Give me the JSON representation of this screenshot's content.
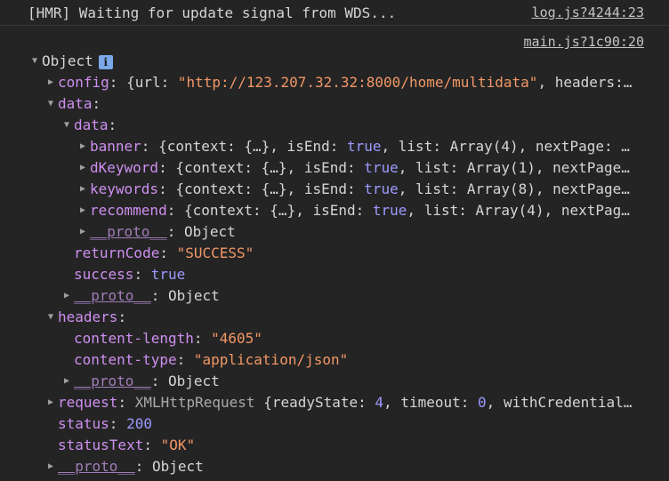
{
  "hmr": {
    "message": "[HMR] Waiting for update signal from WDS...",
    "source": "log.js?4244:23"
  },
  "group": {
    "source": "main.js?1c90:20"
  },
  "root": {
    "label": "Object",
    "info_icon": "info-icon",
    "info_text": "i"
  },
  "config": {
    "key": "config",
    "prefix": "{url: ",
    "url": "\"http://123.207.32.32:8000/home/multidata\"",
    "rest": ", headers:…"
  },
  "data": {
    "key": "data",
    "inner_key": "data",
    "banner": {
      "key": "banner",
      "a": "{context: {…}, isEnd: ",
      "isEnd": "true",
      "b": ", list: ",
      "list": "Array(4)",
      "c": ", nextPage: …"
    },
    "dKeyword": {
      "key": "dKeyword",
      "a": "{context: {…}, isEnd: ",
      "isEnd": "true",
      "b": ", list: ",
      "list": "Array(1)",
      "c": ", nextPage…"
    },
    "keywords": {
      "key": "keywords",
      "a": "{context: {…}, isEnd: ",
      "isEnd": "true",
      "b": ", list: ",
      "list": "Array(8)",
      "c": ", nextPage…"
    },
    "recommend": {
      "key": "recommend",
      "a": "{context: {…}, isEnd: ",
      "isEnd": "true",
      "b": ", list: ",
      "list": "Array(4)",
      "c": ", nextPag…"
    },
    "returnCode_key": "returnCode",
    "returnCode": "\"SUCCESS\"",
    "success_key": "success",
    "success": "true"
  },
  "headers": {
    "key": "headers",
    "content_length_key": "content-length",
    "content_length": "\"4605\"",
    "content_type_key": "content-type",
    "content_type": "\"application/json\""
  },
  "request": {
    "key": "request",
    "cls": "XMLHttpRequest",
    "a": " {readyState: ",
    "readyState": "4",
    "b": ", timeout: ",
    "timeout": "0",
    "c": ", withCredential…"
  },
  "status": {
    "key": "status",
    "value": "200"
  },
  "statusText": {
    "key": "statusText",
    "value": "\"OK\""
  },
  "proto": {
    "key": "__proto__",
    "value": "Object"
  },
  "sep": ": "
}
